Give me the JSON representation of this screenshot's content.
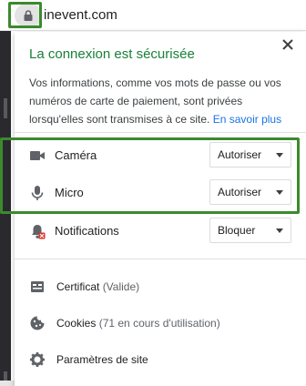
{
  "omnibox": {
    "url_host": "inevent.com",
    "lock_icon": "lock-icon"
  },
  "popup": {
    "title": "La connexion est sécurisée",
    "description": "Vos informations, comme vos mots de passe ou vos numéros de carte de paiement, sont privées lorsqu'elles sont transmises à ce site.",
    "learn_more": "En savoir plus",
    "permissions": [
      {
        "name": "camera",
        "label": "Caméra",
        "value": "Autoriser",
        "icon": "camera-icon"
      },
      {
        "name": "micro",
        "label": "Micro",
        "value": "Autoriser",
        "icon": "microphone-icon"
      },
      {
        "name": "notifications",
        "label": "Notifications",
        "value": "Bloquer",
        "icon": "notifications-blocked-icon"
      }
    ],
    "links": [
      {
        "label": "Certificat",
        "sub": "(Valide)",
        "icon": "certificate-icon"
      },
      {
        "label": "Cookies",
        "sub": "(71 en cours d'utilisation)",
        "icon": "cookie-icon"
      },
      {
        "label": "Paramètres de site",
        "sub": "",
        "icon": "gear-icon"
      }
    ]
  },
  "colors": {
    "title_green": "#188038",
    "link_blue": "#1a73e8",
    "highlight_green": "#3c8a2e"
  }
}
